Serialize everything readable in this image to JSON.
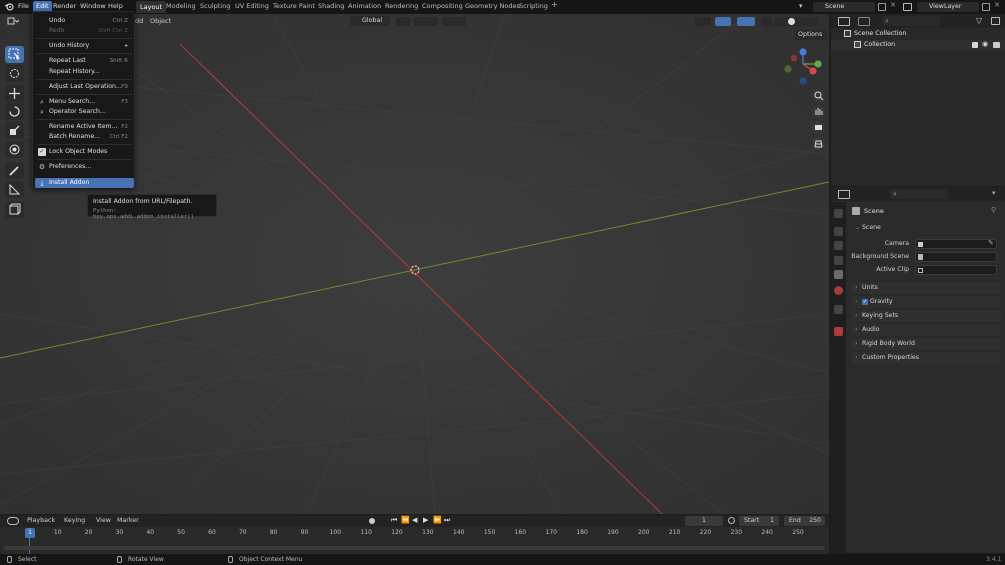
{
  "top_menu": [
    "File",
    "Edit",
    "Render",
    "Window",
    "Help"
  ],
  "workspaces": [
    "Layout",
    "Modeling",
    "Sculpting",
    "UV Editing",
    "Texture Paint",
    "Shading",
    "Animation",
    "Rendering",
    "Compositing",
    "Geometry Nodes",
    "Scripting"
  ],
  "add_tab": "+",
  "scene_name": "Scene",
  "view_layer": "ViewLayer",
  "viewport_header": {
    "add_label": "dd",
    "object_label": "Object",
    "transform": "Global",
    "options": "Options"
  },
  "edit_menu": {
    "undo": {
      "label": "Undo",
      "shortcut": "Ctrl Z"
    },
    "redo": {
      "label": "Redo",
      "shortcut": "Shift Ctrl Z"
    },
    "undo_history": {
      "label": "Undo History"
    },
    "repeat_last": {
      "label": "Repeat Last",
      "shortcut": "Shift R"
    },
    "repeat_history": {
      "label": "Repeat History..."
    },
    "adjust_last": {
      "label": "Adjust Last Operation...",
      "shortcut": "F9"
    },
    "menu_search": {
      "label": "Menu Search...",
      "shortcut": "F3"
    },
    "operator_search": {
      "label": "Operator Search..."
    },
    "rename_active": {
      "label": "Rename Active Item...",
      "shortcut": "F2"
    },
    "batch_rename": {
      "label": "Batch Rename...",
      "shortcut": "Ctrl F2"
    },
    "lock_object_modes": {
      "label": "Lock Object Modes"
    },
    "preferences": {
      "label": "Preferences..."
    },
    "install_addon": {
      "label": "Install Addon"
    }
  },
  "tooltip": {
    "title": "Install Addon from URL/Filepath.",
    "python": "Python: bpy.ops.addi.addon_installer()"
  },
  "outliner": {
    "scene_collection": "Scene Collection",
    "collection": "Collection"
  },
  "properties": {
    "header": "Scene",
    "panel_scene": "Scene",
    "camera_label": "Camera",
    "background_scene_label": "Background Scene",
    "active_clip_label": "Active Clip",
    "panels": [
      "Units",
      "Gravity",
      "Keying Sets",
      "Audio",
      "Rigid Body World",
      "Custom Properties"
    ]
  },
  "timeline": {
    "menus": [
      "Playback",
      "Keying",
      "View",
      "Marker"
    ],
    "current_frame": "1",
    "start_label": "Start",
    "start": "1",
    "end_label": "End",
    "end": "250",
    "ticks": [
      "1",
      "10",
      "20",
      "30",
      "40",
      "50",
      "60",
      "70",
      "80",
      "90",
      "100",
      "110",
      "120",
      "130",
      "140",
      "150",
      "160",
      "170",
      "180",
      "190",
      "200",
      "210",
      "220",
      "230",
      "240",
      "250"
    ]
  },
  "status": {
    "select": "Select",
    "rotate_view": "Rotate View",
    "context_menu": "Object Context Menu",
    "version": "3.4.1"
  },
  "colors": {
    "accent": "#4772b3",
    "x_axis": "#b83b3b",
    "y_axis": "#6b8f2e"
  }
}
